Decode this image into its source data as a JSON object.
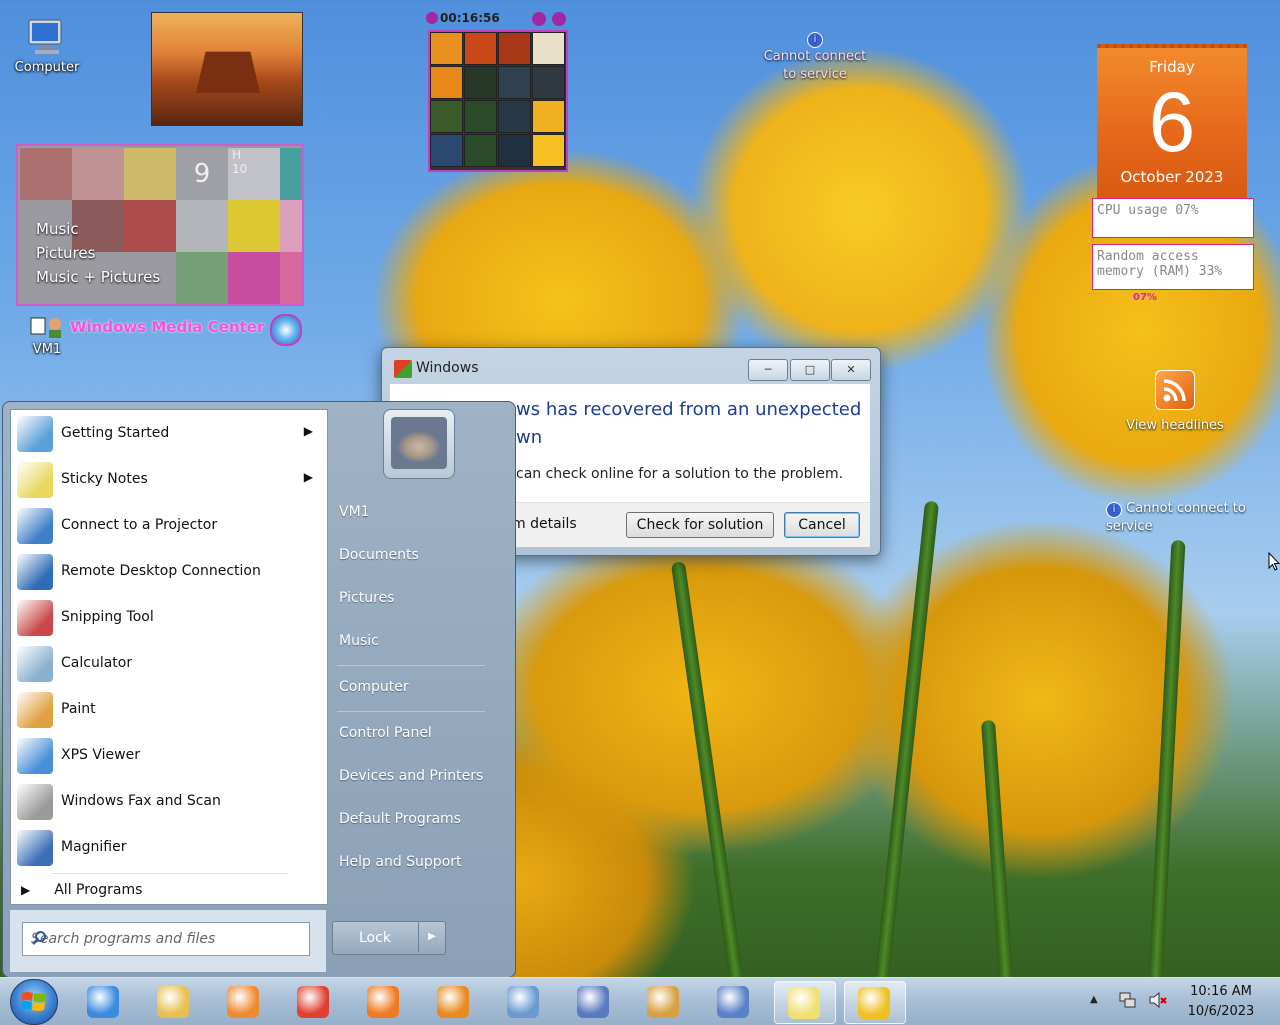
{
  "desktop": {
    "icons": [
      {
        "label": "Computer"
      },
      {
        "label": "VM1"
      }
    ]
  },
  "wmc": {
    "menu": [
      "Music",
      "Pictures",
      "Music + Pictures"
    ],
    "title": "Windows Media Center",
    "tile_digit": "9",
    "tile_top": "H",
    "tile_num": "10"
  },
  "puzzle": {
    "time": "00:16:56"
  },
  "notices": {
    "top": "Cannot connect to service",
    "right": "Cannot connect to service"
  },
  "calendar": {
    "day": "Friday",
    "date": "6",
    "month": "October 2023"
  },
  "meters": {
    "cpu": "CPU usage  07%",
    "ram": "Random access memory (RAM)  33%",
    "small": "07%"
  },
  "rss": {
    "label": "View headlines"
  },
  "dialog": {
    "title": "Windows",
    "heading": "Windows has recovered from an unexpected shutdown",
    "heading_visible_1": "ws has recovered from an unexpected",
    "heading_visible_2": "wn",
    "description": "can check online for a solution to the problem.",
    "details": "m details",
    "check_button": "Check for solution",
    "cancel_button": "Cancel"
  },
  "start_menu": {
    "programs": [
      {
        "label": "Getting Started",
        "submenu": true,
        "color": "#5aa0d8"
      },
      {
        "label": "Sticky Notes",
        "submenu": true,
        "color": "#e8d860"
      },
      {
        "label": "Connect to a Projector",
        "submenu": false,
        "color": "#3f7fc8"
      },
      {
        "label": "Remote Desktop Connection",
        "submenu": false,
        "color": "#2f6cb8"
      },
      {
        "label": "Snipping Tool",
        "submenu": false,
        "color": "#c84848"
      },
      {
        "label": "Calculator",
        "submenu": false,
        "color": "#8ab0d0"
      },
      {
        "label": "Paint",
        "submenu": false,
        "color": "#e0a040"
      },
      {
        "label": "XPS Viewer",
        "submenu": false,
        "color": "#4a90d8"
      },
      {
        "label": "Windows Fax and Scan",
        "submenu": false,
        "color": "#9a9a9a"
      },
      {
        "label": "Magnifier",
        "submenu": false,
        "color": "#3c6eb8"
      }
    ],
    "all_programs": "All Programs",
    "search_placeholder": "Search programs and files",
    "right_items": [
      "VM1",
      "Documents",
      "Pictures",
      "Music",
      "Computer",
      "Control Panel",
      "Devices and Printers",
      "Default Programs",
      "Help and Support"
    ],
    "lock_label": "Lock"
  },
  "taskbar": {
    "time": "10:16 AM",
    "date": "10/6/2023",
    "apps": [
      "ie-icon",
      "explorer-icon",
      "media-player-icon",
      "chrome-icon",
      "firefox-icon",
      "search-tool-icon",
      "control-panel-icon",
      "paint-icon",
      "system-icon",
      "remote-desktop-icon",
      "sticky-notes-icon",
      "windows-error-icon"
    ]
  }
}
